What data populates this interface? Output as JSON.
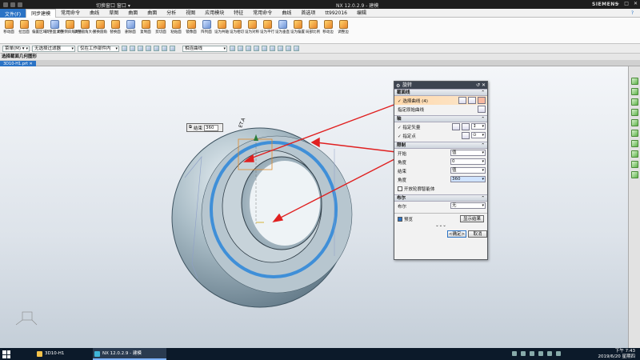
{
  "window": {
    "title": "NX 12.0.2.9 - 建模",
    "brand": "SIEMENS",
    "quick_access": "切换窗口 窗口 ▾"
  },
  "menu": {
    "file": "文件(F)",
    "tabs": [
      "同步建模",
      "常用命令",
      "曲线",
      "草图",
      "曲面",
      "曲面",
      "分析",
      "视图",
      "应用模块",
      "特征",
      "常用命令",
      "曲线",
      "首选项",
      "tt992016",
      "编辑"
    ],
    "active_index": 0
  },
  "ribbon": {
    "buttons": [
      "移动面",
      "拉出面",
      "偏置区域",
      "调整面大小",
      "调整倒斜角大小",
      "调整圆角大小",
      "替换圆角",
      "替换面",
      "删除面",
      "复制面",
      "剪切面",
      "粘贴面",
      "镜像面",
      "阵列面",
      "设为共轴",
      "设为相切",
      "设为对称",
      "设为平行",
      "设为垂直",
      "设为偏置",
      "局部比例",
      "移动边",
      "调整边"
    ]
  },
  "selbar": {
    "menu_label": "菜单(M) ▾",
    "filter": "无选择过滤器",
    "scope": "仅在工作部件内",
    "curve_rule": "相连曲线"
  },
  "status": "选择截面几何图形",
  "doc_tab": "3D10-H1.prt ✕",
  "length_box": {
    "label": "结束",
    "value": "360"
  },
  "dialog": {
    "title": "旋转",
    "sec_section": "截面线",
    "select_curve": "✓ 选择曲线 (4)",
    "origin_curve": "指定原始曲线",
    "sec_axis": "轴",
    "vector": "✓ 指定矢量",
    "point": "✓ 指定点",
    "sec_limits": "限制",
    "start": "开始",
    "start_mode": "值",
    "angle_label": "角度",
    "start_angle": "0",
    "end": "结束",
    "end_mode": "值",
    "end_angle_label": "角度",
    "end_angle": "360",
    "open_profile": "开放轮廓智能体",
    "sec_bool": "布尔",
    "bool_label": "布尔",
    "bool_value": "无",
    "preview": "预览",
    "show_result": "显示结果",
    "more": "⌄⌄⌄",
    "ok": "<确定>",
    "cancel": "取消"
  },
  "taskbar": {
    "apps": [
      "3D10-H1",
      "NX 12.0.2.9 - 建模"
    ],
    "time": "下午 7:43",
    "date": "2019/6/20 星期四"
  },
  "colors": {
    "accent": "#2b73c5",
    "dialog_title": "#3d4450",
    "highlight": "#ffd9ac",
    "arrow": "#e02020"
  }
}
